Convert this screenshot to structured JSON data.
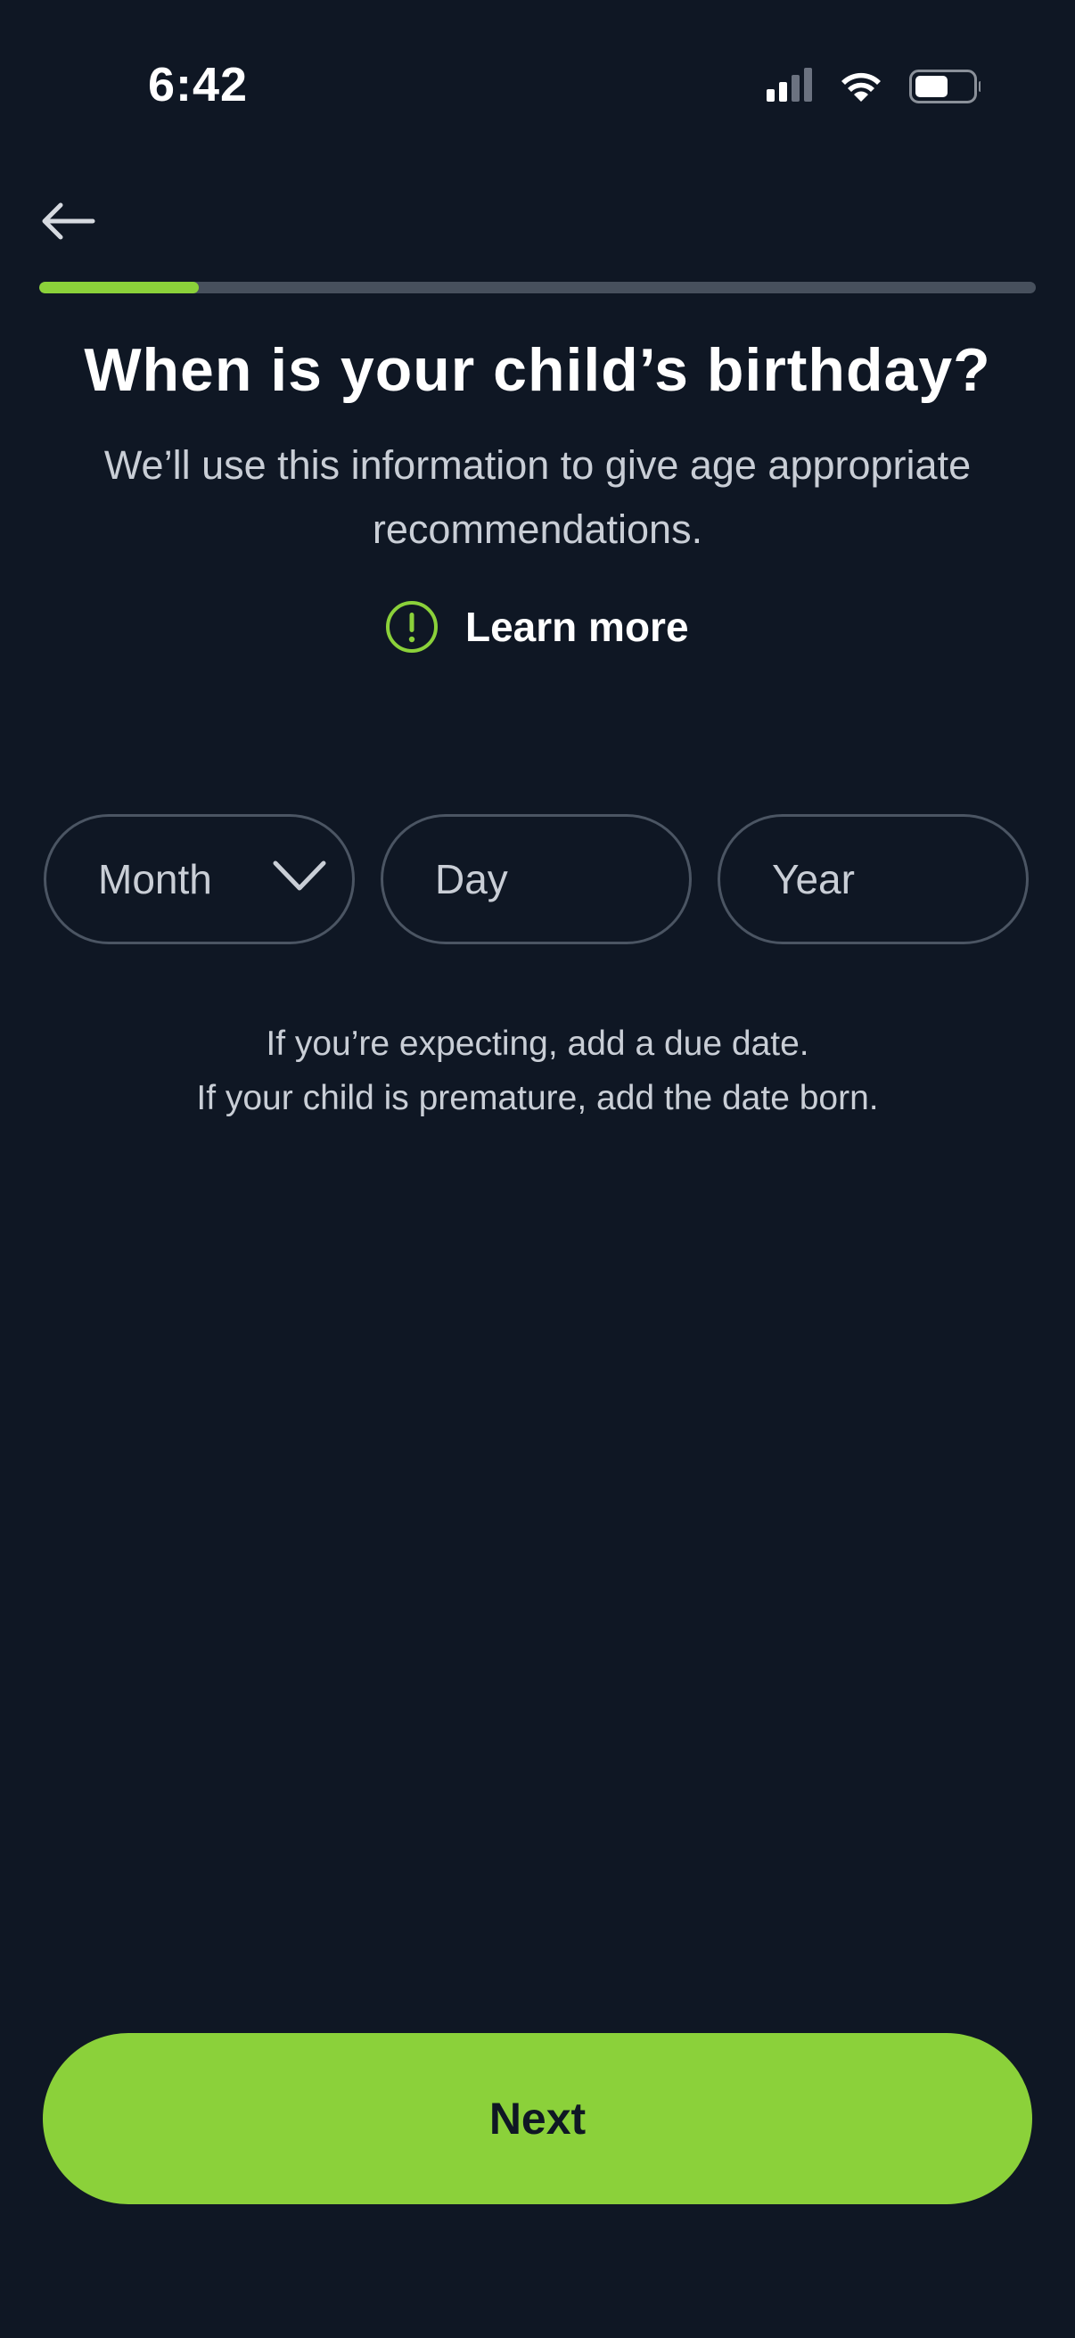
{
  "status_bar": {
    "time": "6:42",
    "icons": [
      "cellular-signal-icon",
      "wifi-icon",
      "battery-icon"
    ]
  },
  "header": {
    "back_icon": "arrow-left-icon",
    "progress": 0.16
  },
  "title": "When is your child’s birthday?",
  "subtitle": "We’ll use this information to give age appropriate recommendations.",
  "learn_more": {
    "icon": "alert-circle-icon",
    "label": "Learn more"
  },
  "date_fields": {
    "month_placeholder": "Month",
    "day_placeholder": "Day",
    "year_placeholder": "Year",
    "month_icon": "chevron-down-icon"
  },
  "hint": {
    "line1": "If you’re expecting, add a due date.",
    "line2": "If your child is premature, add the date born."
  },
  "next_button": {
    "label": "Next"
  },
  "colors": {
    "background": "#0f1724",
    "accent": "#8bd13a",
    "field_border": "#4b5563",
    "muted_text": "#c9ced6",
    "track": "#47505d"
  }
}
